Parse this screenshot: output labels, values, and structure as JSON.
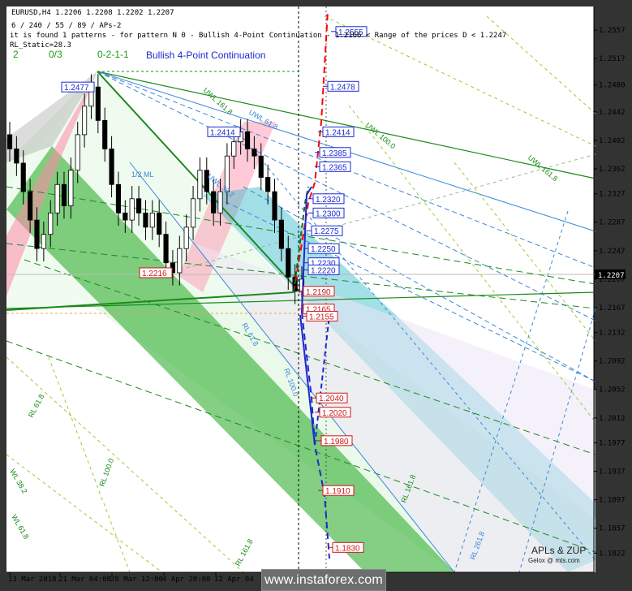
{
  "header": {
    "symbol_line": "EURUSD,H4  1.2206 1.2208 1.2202 1.2207",
    "params_line": "6 / 240 / 55 / 89 / APs-2",
    "pattern_line": "it is found 1 patterns  -  for pattern N 0 - Bullish 4-Point Continuation - 1.2166 < Range of the prices D < 1.2247",
    "static_line": "RL_Static=28.3",
    "count_a": "2",
    "count_b": "0/3",
    "wave_code": "0-2-1-1",
    "pattern_name": "Bullish 4-Point Continuation"
  },
  "colors": {
    "background": "#ffffff",
    "bull_green": "#1fa81f",
    "bear_pink": "#ff8aa8",
    "channel_cyan": "#30b8c8",
    "level_blue": "#1b2ad0",
    "level_red": "#d01818",
    "target_red": "#ff0000"
  },
  "chart_data": {
    "type": "line",
    "symbol": "EURUSD",
    "timeframe": "H4",
    "ylim": [
      1.1803,
      1.2581
    ],
    "y_ticks": [
      "1.2557",
      "1.2517",
      "1.2480",
      "1.2442",
      "1.2402",
      "1.2362",
      "1.2327",
      "1.2287",
      "1.2247",
      "1.2207",
      "1.2167",
      "1.2132",
      "1.2092",
      "1.2052",
      "1.2012",
      "1.1977",
      "1.1937",
      "1.1897",
      "1.1857",
      "1.1822"
    ],
    "x_ticks": [
      "13 Mar 2018",
      "21 Mar 04:00",
      "28 Mar 12:00",
      "4 Apr 20:00",
      "12 Apr 04"
    ],
    "current_price": "1.2207",
    "pivot_labels": [
      {
        "text": "1.2477",
        "price": 1.2477,
        "color": "blue"
      },
      {
        "text": "1.2414",
        "price": 1.2414,
        "color": "blue"
      },
      {
        "text": "1.2216",
        "price": 1.2216,
        "color": "red"
      }
    ],
    "target_levels": [
      {
        "text": "1.2555",
        "price": 1.2555,
        "color": "blue"
      },
      {
        "text": "1.2478",
        "price": 1.2478,
        "color": "blue"
      },
      {
        "text": "1.2414",
        "price": 1.2414,
        "color": "blue"
      },
      {
        "text": "1.2385",
        "price": 1.2385,
        "color": "blue"
      },
      {
        "text": "1.2365",
        "price": 1.2365,
        "color": "blue"
      },
      {
        "text": "1.2320",
        "price": 1.232,
        "color": "blue"
      },
      {
        "text": "1.2300",
        "price": 1.23,
        "color": "blue"
      },
      {
        "text": "1.2275",
        "price": 1.2275,
        "color": "blue"
      },
      {
        "text": "1.2250",
        "price": 1.225,
        "color": "blue"
      },
      {
        "text": "1.2230",
        "price": 1.223,
        "color": "blue"
      },
      {
        "text": "1.2220",
        "price": 1.222,
        "color": "blue"
      },
      {
        "text": "1.2190",
        "price": 1.219,
        "color": "red"
      },
      {
        "text": "1.2165",
        "price": 1.2165,
        "color": "red"
      },
      {
        "text": "1.2155",
        "price": 1.2155,
        "color": "red"
      },
      {
        "text": "1.2040",
        "price": 1.204,
        "color": "red"
      },
      {
        "text": "1.2020",
        "price": 1.202,
        "color": "red"
      },
      {
        "text": "1.1980",
        "price": 1.198,
        "color": "red"
      },
      {
        "text": "1.1910",
        "price": 1.191,
        "color": "red"
      },
      {
        "text": "1.1830",
        "price": 1.183,
        "color": "red"
      }
    ],
    "close_series": [
      1.239,
      1.237,
      1.233,
      1.229,
      1.225,
      1.227,
      1.23,
      1.234,
      1.231,
      1.236,
      1.241,
      1.245,
      1.2477,
      1.243,
      1.239,
      1.234,
      1.23,
      1.229,
      1.232,
      1.23,
      1.228,
      1.23,
      1.227,
      1.223,
      1.2216,
      1.225,
      1.228,
      1.232,
      1.236,
      1.233,
      1.23,
      1.233,
      1.238,
      1.24,
      1.2414,
      1.239,
      1.238,
      1.235,
      1.233,
      1.229,
      1.225,
      1.221,
      1.219,
      1.2207
    ],
    "line_tags": [
      "UWL 161.8",
      "UWL 61.8",
      "UWL 100.0",
      "UWL 161.8",
      "1/2 ML",
      "RL 61.8",
      "RL 100.0",
      "RL 100.0",
      "RL 161.8",
      "RL 161.8",
      "RL 61.8",
      "WL 38.2",
      "WL 61.8",
      "RL 261.8",
      "UWL 38.2"
    ]
  },
  "watermark": {
    "brand": "APLs & ZUP",
    "email": "Gelox @ mts.com",
    "site": "www.instaforex.com"
  }
}
